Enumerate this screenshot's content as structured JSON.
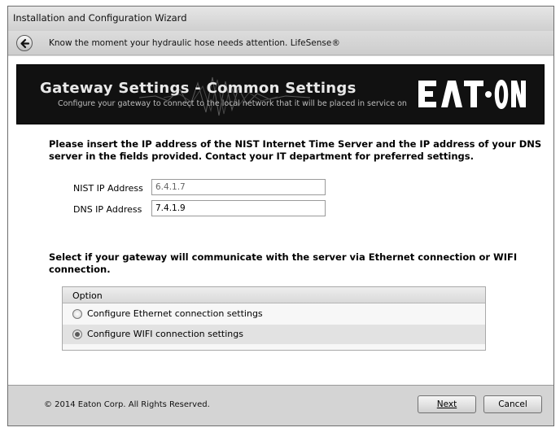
{
  "window": {
    "title": "Installation and Configuration Wizard"
  },
  "navbar": {
    "back_icon": "back-arrow-icon",
    "tagline": "Know the moment your hydraulic hose needs attention.  LifeSense®"
  },
  "banner": {
    "title": "Gateway Settings - Common Settings",
    "subtitle": "Configure your gateway to connect to the local network that it will be placed in service on",
    "logo_text": "EATON"
  },
  "main": {
    "instructions": "Please insert the IP address of the NIST Internet Time Server and the IP address of your DNS server in the fields provided.  Contact your IT department for preferred settings.",
    "nist": {
      "label": "NIST IP Address",
      "value": "6.4.1.7"
    },
    "dns": {
      "label": "DNS IP Address",
      "value": "7.4.1.9"
    },
    "select_prompt": "Select if your gateway will communicate with the server via Ethernet connection or WIFI connection.",
    "options": {
      "header": "Option",
      "items": [
        {
          "label": "Configure Ethernet connection settings",
          "checked": false
        },
        {
          "label": "Configure WIFI connection settings",
          "checked": true
        }
      ]
    }
  },
  "footer": {
    "copyright": "© 2014 Eaton Corp.  All Rights Reserved.",
    "next_label": "Next",
    "cancel_label": "Cancel"
  }
}
